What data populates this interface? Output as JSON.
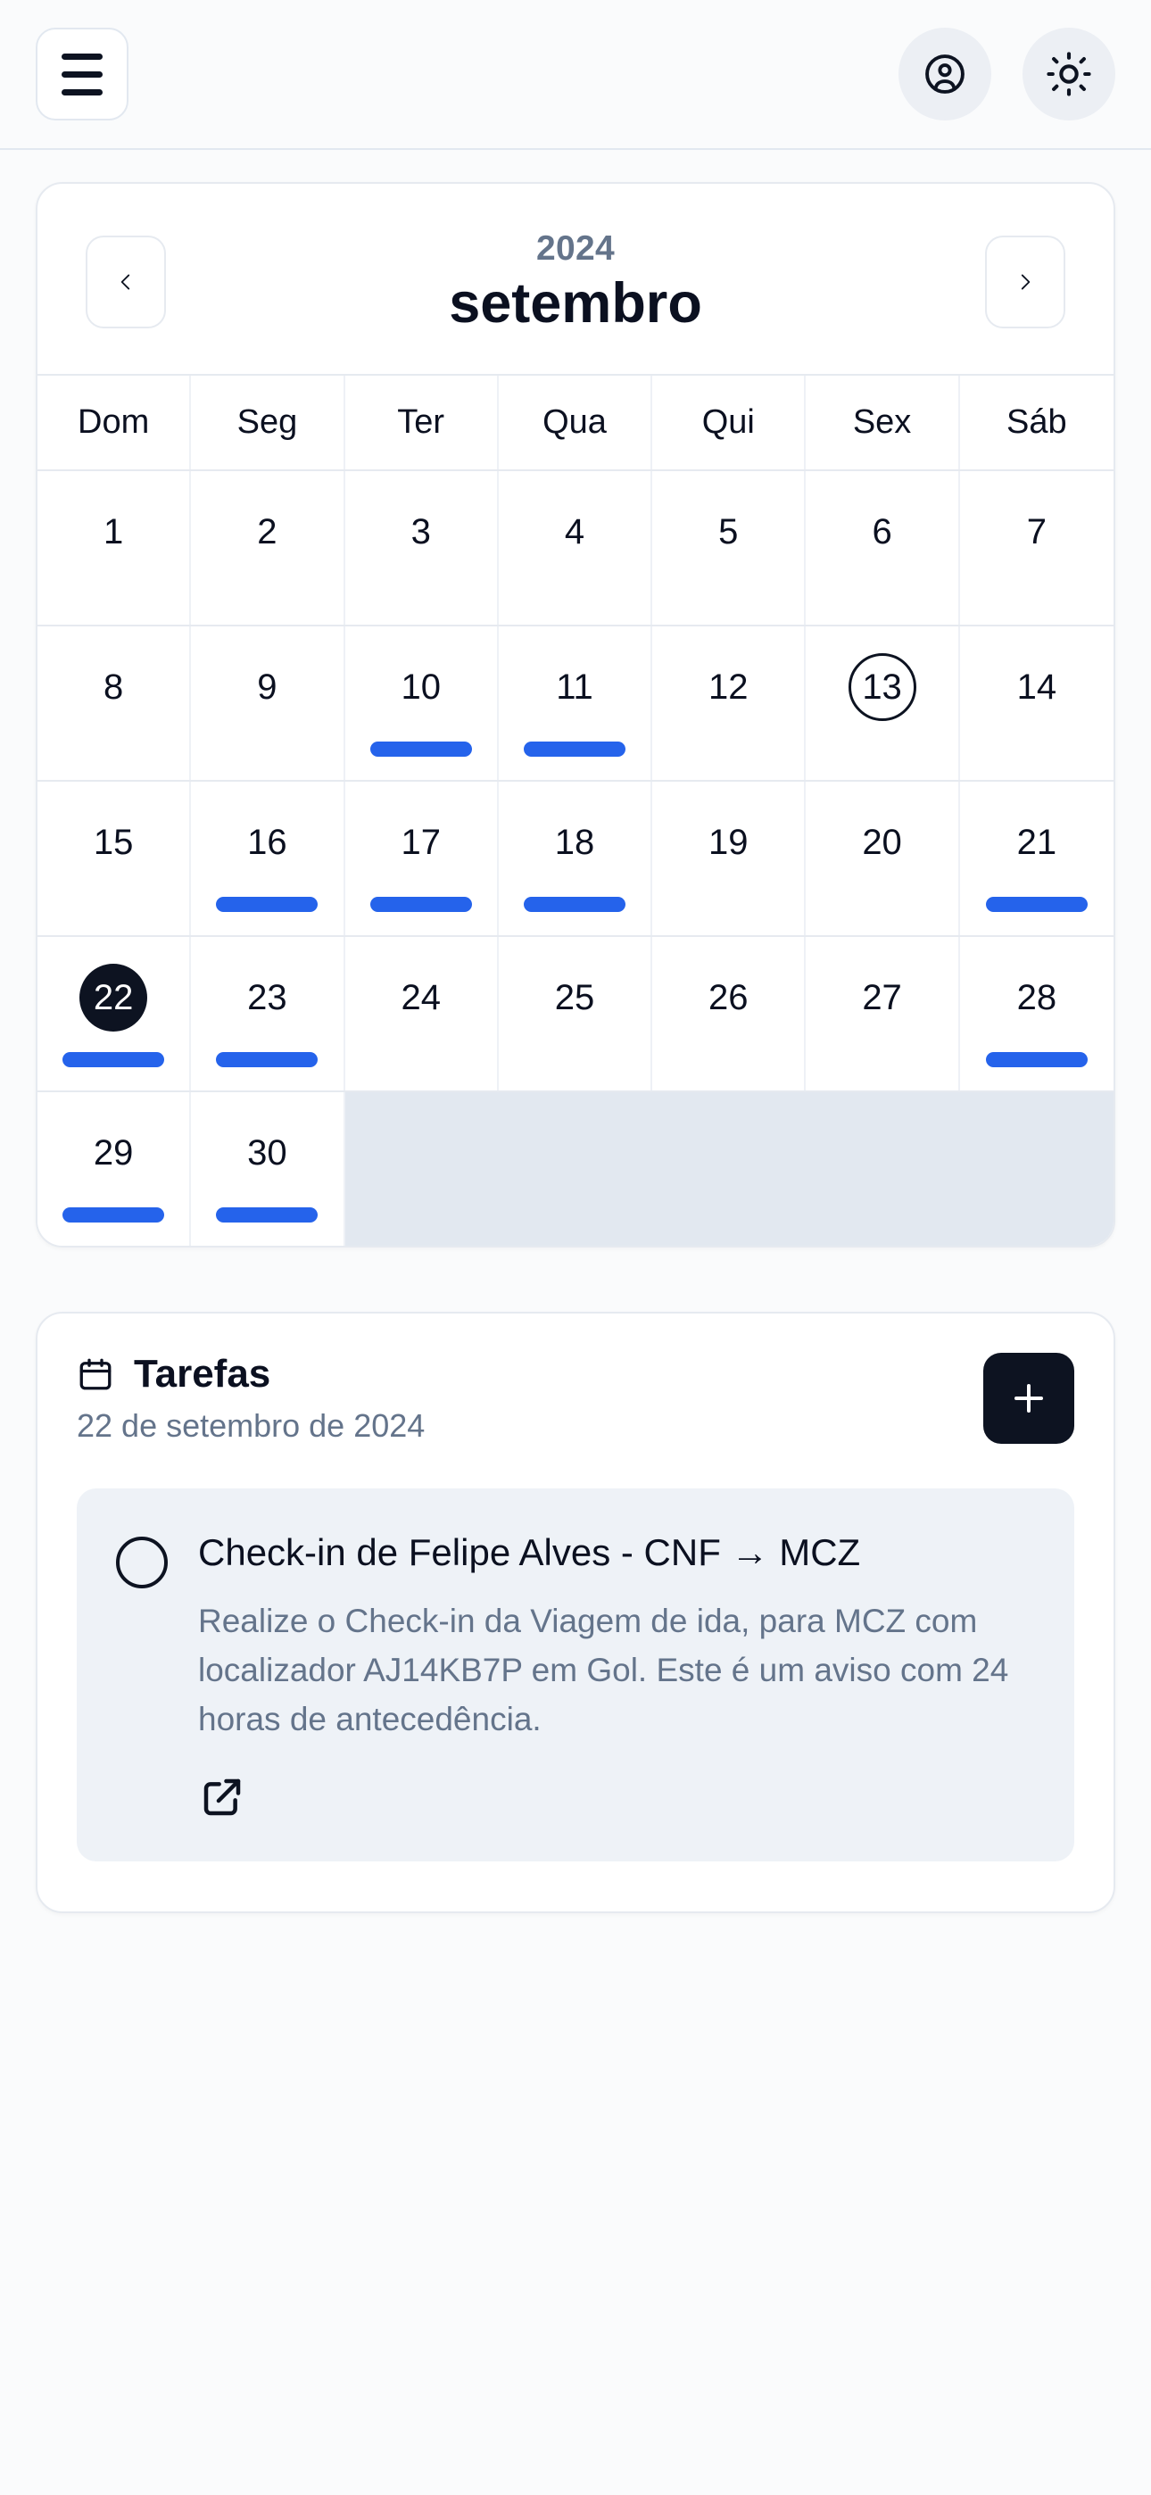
{
  "topbar": {
    "menu_icon": "hamburger-menu-icon",
    "profile_icon": "user-circle-icon",
    "theme_icon": "sun-icon"
  },
  "calendar": {
    "prev_label": "‹",
    "next_label": "›",
    "year": "2024",
    "month": "setembro",
    "weekdays": [
      "Dom",
      "Seg",
      "Ter",
      "Qua",
      "Qui",
      "Sex",
      "Sáb"
    ],
    "accent_event_color": "#2563eb",
    "selected_color": "#0d1321",
    "weeks": [
      [
        {
          "day": "1",
          "event": false,
          "today": false,
          "selected": false
        },
        {
          "day": "2",
          "event": false,
          "today": false,
          "selected": false
        },
        {
          "day": "3",
          "event": false,
          "today": false,
          "selected": false
        },
        {
          "day": "4",
          "event": false,
          "today": false,
          "selected": false
        },
        {
          "day": "5",
          "event": false,
          "today": false,
          "selected": false
        },
        {
          "day": "6",
          "event": false,
          "today": false,
          "selected": false
        },
        {
          "day": "7",
          "event": false,
          "today": false,
          "selected": false
        }
      ],
      [
        {
          "day": "8",
          "event": false,
          "today": false,
          "selected": false
        },
        {
          "day": "9",
          "event": false,
          "today": false,
          "selected": false
        },
        {
          "day": "10",
          "event": true,
          "today": false,
          "selected": false
        },
        {
          "day": "11",
          "event": true,
          "today": false,
          "selected": false
        },
        {
          "day": "12",
          "event": false,
          "today": false,
          "selected": false
        },
        {
          "day": "13",
          "event": false,
          "today": true,
          "selected": false
        },
        {
          "day": "14",
          "event": false,
          "today": false,
          "selected": false
        }
      ],
      [
        {
          "day": "15",
          "event": false,
          "today": false,
          "selected": false
        },
        {
          "day": "16",
          "event": true,
          "today": false,
          "selected": false
        },
        {
          "day": "17",
          "event": true,
          "today": false,
          "selected": false
        },
        {
          "day": "18",
          "event": true,
          "today": false,
          "selected": false
        },
        {
          "day": "19",
          "event": false,
          "today": false,
          "selected": false
        },
        {
          "day": "20",
          "event": false,
          "today": false,
          "selected": false
        },
        {
          "day": "21",
          "event": true,
          "today": false,
          "selected": false
        }
      ],
      [
        {
          "day": "22",
          "event": true,
          "today": false,
          "selected": true
        },
        {
          "day": "23",
          "event": true,
          "today": false,
          "selected": false
        },
        {
          "day": "24",
          "event": false,
          "today": false,
          "selected": false
        },
        {
          "day": "25",
          "event": false,
          "today": false,
          "selected": false
        },
        {
          "day": "26",
          "event": false,
          "today": false,
          "selected": false
        },
        {
          "day": "27",
          "event": false,
          "today": false,
          "selected": false
        },
        {
          "day": "28",
          "event": true,
          "today": false,
          "selected": false
        }
      ],
      [
        {
          "day": "29",
          "event": true,
          "today": false,
          "selected": false
        },
        {
          "day": "30",
          "event": true,
          "today": false,
          "selected": false
        },
        {
          "day": "",
          "event": false,
          "today": false,
          "selected": false,
          "blank": true
        },
        {
          "day": "",
          "event": false,
          "today": false,
          "selected": false,
          "blank": true
        },
        {
          "day": "",
          "event": false,
          "today": false,
          "selected": false,
          "blank": true
        },
        {
          "day": "",
          "event": false,
          "today": false,
          "selected": false,
          "blank": true
        },
        {
          "day": "",
          "event": false,
          "today": false,
          "selected": false,
          "blank": true
        }
      ]
    ]
  },
  "tasks": {
    "icon": "calendar-icon",
    "title": "Tarefas",
    "subtitle": "22 de setembro de 2024",
    "add_icon": "plus-icon",
    "items": [
      {
        "checkbox_icon": "circle-unchecked-icon",
        "title": "Check-in de Felipe Alves - CNF → MCZ",
        "description": "Realize o Check-in da Viagem de ida, para MCZ com localizador AJ14KB7P em Gol. Este é um aviso com 24 horas de antecedência.",
        "link_icon": "external-link-icon"
      }
    ]
  }
}
